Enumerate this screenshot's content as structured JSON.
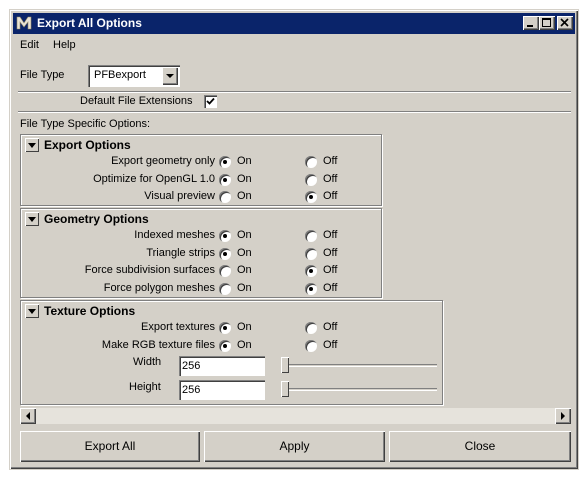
{
  "window": {
    "title": "Export All Options",
    "controls": [
      "minimize-icon",
      "maximize-icon",
      "close-icon"
    ]
  },
  "menubar": {
    "items": [
      "Edit",
      "Help"
    ]
  },
  "file_type": {
    "label": "File Type",
    "selected": "PFBexport"
  },
  "default_extensions": {
    "label": "Default File Extensions",
    "checked": true
  },
  "specific_heading": "File Type Specific Options:",
  "sections": {
    "export": {
      "title": "Export Options",
      "rows": [
        {
          "label": "Export geometry only",
          "on": "On",
          "off": "Off",
          "selected": "On"
        },
        {
          "label": "Optimize for OpenGL 1.0",
          "on": "On",
          "off": "Off",
          "selected": "On"
        },
        {
          "label": "Visual preview",
          "on": "On",
          "off": "Off",
          "selected": "Off"
        }
      ]
    },
    "geometry": {
      "title": "Geometry Options",
      "rows": [
        {
          "label": "Indexed meshes",
          "on": "On",
          "off": "Off",
          "selected": "On"
        },
        {
          "label": "Triangle strips",
          "on": "On",
          "off": "Off",
          "selected": "On"
        },
        {
          "label": "Force subdivision surfaces",
          "on": "On",
          "off": "Off",
          "selected": "Off"
        },
        {
          "label": "Force polygon meshes",
          "on": "On",
          "off": "Off",
          "selected": "Off"
        }
      ]
    },
    "texture": {
      "title": "Texture Options",
      "rows": [
        {
          "label": "Export textures",
          "on": "On",
          "off": "Off",
          "selected": "On"
        },
        {
          "label": "Make RGB texture files",
          "on": "On",
          "off": "Off",
          "selected": "On"
        }
      ],
      "width": {
        "label": "Width",
        "value": "256",
        "slider_fraction": 0.0
      },
      "height": {
        "label": "Height",
        "value": "256",
        "slider_fraction": 0.0
      }
    }
  },
  "buttons": {
    "export_all": "Export All",
    "apply": "Apply",
    "close": "Close"
  },
  "colors": {
    "titlebar": "#0a246a",
    "face": "#d4d0c8"
  }
}
